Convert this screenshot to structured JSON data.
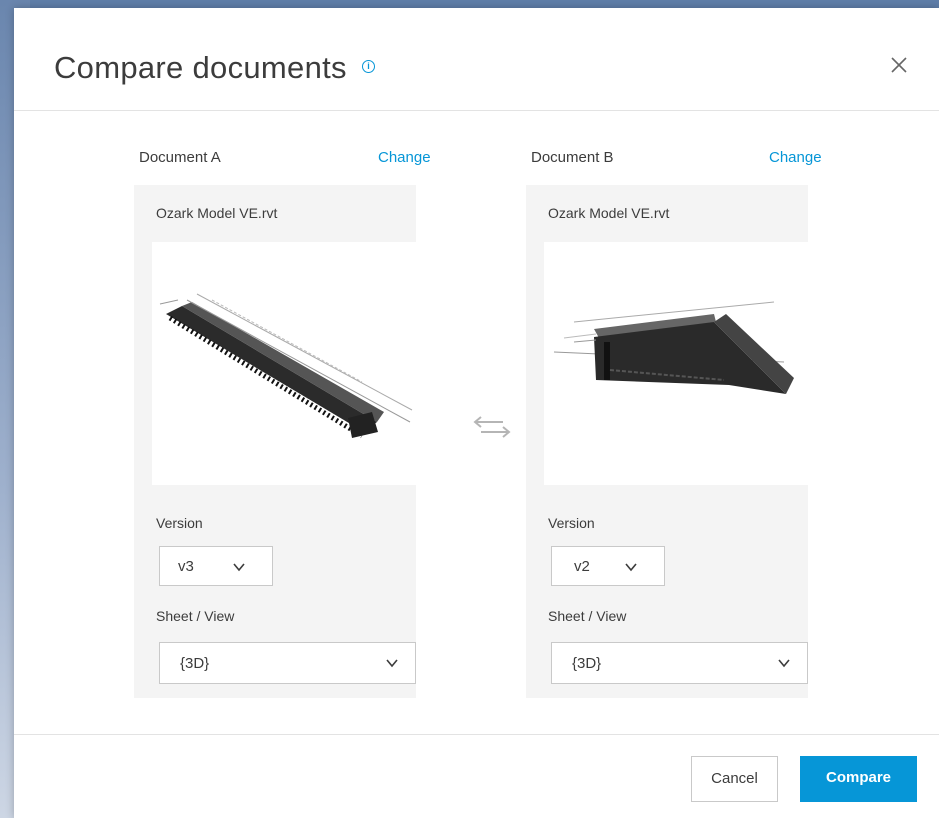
{
  "dialog": {
    "title": "Compare documents",
    "info_icon": "info-circle-icon",
    "close_icon": "close-icon"
  },
  "document_a": {
    "label": "Document A",
    "change_label": "Change",
    "file_name": "Ozark Model VE.rvt",
    "version_label": "Version",
    "version_value": "v3",
    "sheet_label": "Sheet / View",
    "sheet_value": "{3D}"
  },
  "document_b": {
    "label": "Document B",
    "change_label": "Change",
    "file_name": "Ozark Model VE.rvt",
    "version_label": "Version",
    "version_value": "v2",
    "sheet_label": "Sheet / View",
    "sheet_value": "{3D}"
  },
  "swap_icon": "swap-arrows-icon",
  "footer": {
    "cancel_label": "Cancel",
    "compare_label": "Compare"
  },
  "colors": {
    "accent": "#0696d7",
    "text": "#3c3c3c",
    "panel_bg": "#f4f4f4"
  }
}
